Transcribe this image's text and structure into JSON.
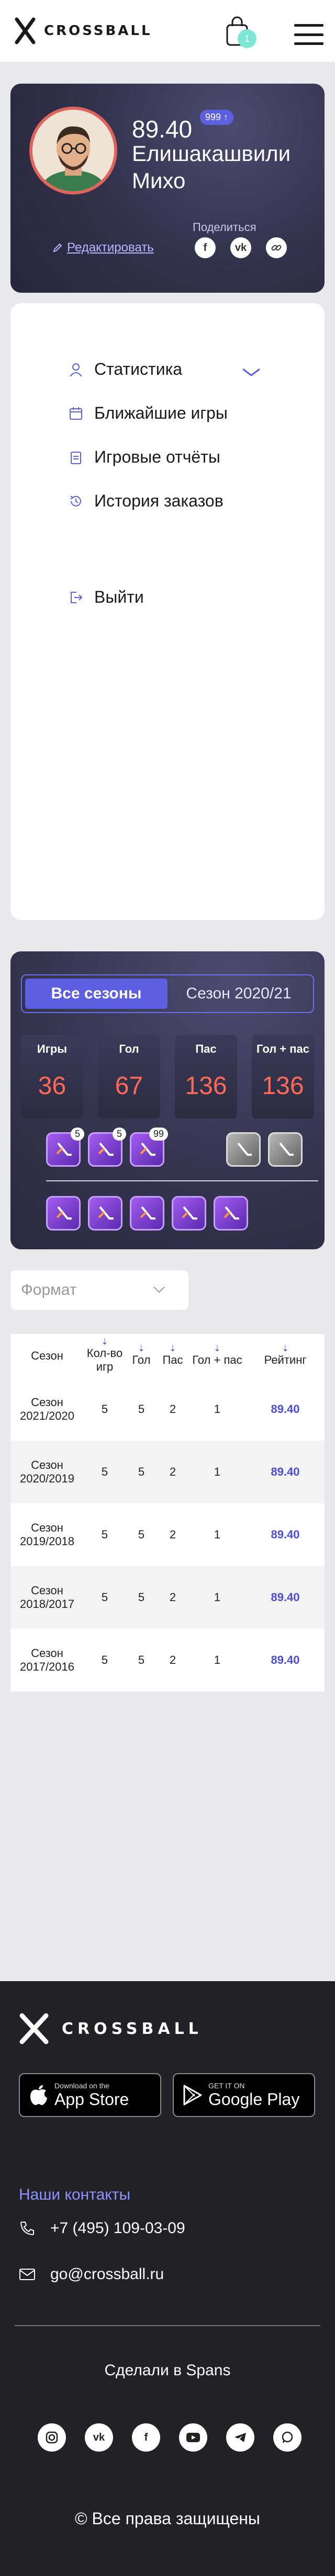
{
  "header": {
    "logo_text": "CROSSBALL",
    "cart_count": "1"
  },
  "profile": {
    "rating": "89.40",
    "rating_badge": "999 ↑",
    "name": "Елишакашвили Михо",
    "edit_label": "Редактировать",
    "share_label": "Поделиться",
    "share_icons": [
      "facebook-icon",
      "vk-icon",
      "link-icon"
    ]
  },
  "menu": {
    "items": [
      {
        "label": "Статистика",
        "icon": "user-icon"
      },
      {
        "label": "Ближайшие игры",
        "icon": "calendar-icon"
      },
      {
        "label": "Игровые отчёты",
        "icon": "clipboard-icon"
      },
      {
        "label": "История заказов",
        "icon": "history-icon"
      }
    ],
    "logout_label": "Выйти"
  },
  "stats": {
    "tabs": [
      "Все сезоны",
      "Сезон 2020/21"
    ],
    "active_tab": 0,
    "cards": [
      {
        "label": "Игры",
        "value": "36"
      },
      {
        "label": "Гол",
        "value": "67"
      },
      {
        "label": "Пас",
        "value": "136"
      },
      {
        "label": "Гол + пас",
        "value": "136"
      }
    ],
    "badge_counts": [
      "5",
      "5",
      "99"
    ]
  },
  "format": {
    "placeholder": "Формат"
  },
  "table": {
    "headers": [
      "Сезон",
      "Кол-во игр",
      "Гол",
      "Пас",
      "Гол + пас",
      "Рейтинг"
    ],
    "rows": [
      [
        "Сезон 2021/2020",
        "5",
        "5",
        "2",
        "1",
        "89.40"
      ],
      [
        "Сезон 2020/2019",
        "5",
        "5",
        "2",
        "1",
        "89.40"
      ],
      [
        "Сезон 2019/2018",
        "5",
        "5",
        "2",
        "1",
        "89.40"
      ],
      [
        "Сезон 2018/2017",
        "5",
        "5",
        "2",
        "1",
        "89.40"
      ],
      [
        "Сезон 2017/2016",
        "5",
        "5",
        "2",
        "1",
        "89.40"
      ]
    ]
  },
  "footer": {
    "logo_text": "CROSSBALL",
    "appstore_small": "Download on the",
    "appstore_big": "App Store",
    "googleplay_small": "GET IT ON",
    "googleplay_big": "Google Play",
    "contacts_title": "Наши контакты",
    "phone": "+7 (495) 109-03-09",
    "email": "go@crossball.ru",
    "made_in": "Сделали в Spans",
    "socials": [
      "instagram-icon",
      "vk-icon",
      "facebook-icon",
      "youtube-icon",
      "telegram-icon",
      "whatsapp-icon"
    ],
    "copyright": "© Все права защищены"
  },
  "colors": {
    "accent": "#5b5fe0",
    "stat_value": "#ff6a55",
    "rating": "#4b4ed8",
    "link": "#8f93ff"
  }
}
